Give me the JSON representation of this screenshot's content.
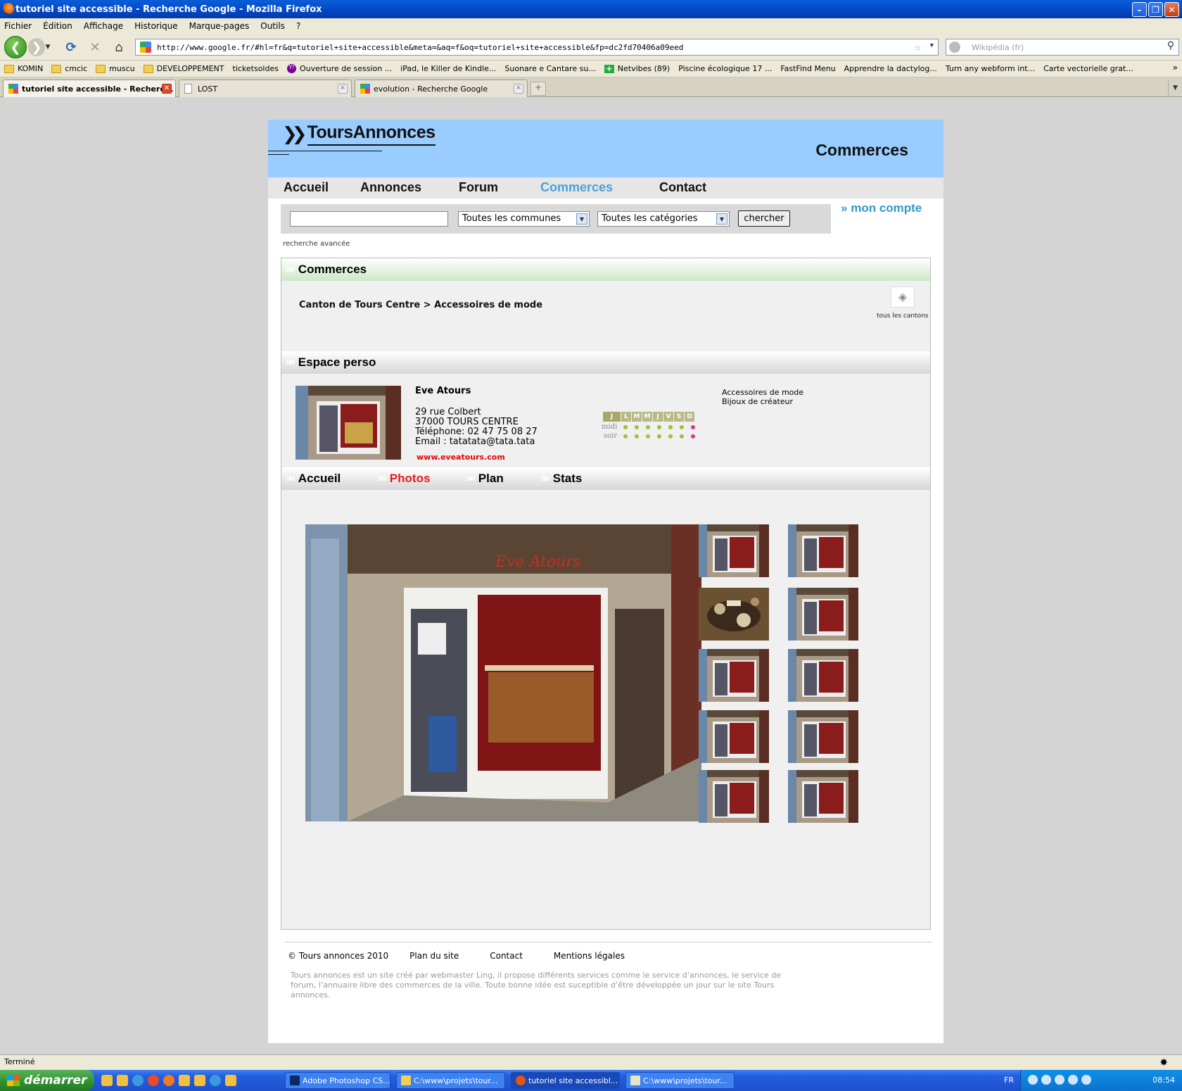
{
  "window": {
    "title": "tutoriel site accessible - Recherche Google - Mozilla Firefox"
  },
  "menu": [
    "Fichier",
    "Édition",
    "Affichage",
    "Historique",
    "Marque-pages",
    "Outils",
    "?"
  ],
  "urlbar": {
    "value": "http://www.google.fr/#hl=fr&q=tutoriel+site+accessible&meta=&aq=f&oq=tutoriel+site+accessible&fp=dc2fd70406a09eed"
  },
  "searchbar": {
    "placeholder": "Wikipédia (fr)"
  },
  "bookmarks": [
    {
      "label": "KOMIN",
      "icon": "folder"
    },
    {
      "label": "cmcic",
      "icon": "folder"
    },
    {
      "label": "muscu",
      "icon": "folder"
    },
    {
      "label": "DEVELOPPEMENT",
      "icon": "folder"
    },
    {
      "label": "ticketsoldes",
      "icon": "page"
    },
    {
      "label": "Ouverture de session ...",
      "icon": "yahoo"
    },
    {
      "label": "iPad, le Killer de Kindle...",
      "icon": "page"
    },
    {
      "label": "Suonare e Cantare su...",
      "icon": "page"
    },
    {
      "label": "Netvibes (89)",
      "icon": "plus"
    },
    {
      "label": "Piscine écologique 17 ...",
      "icon": "page"
    },
    {
      "label": "FastFind Menu",
      "icon": "page"
    },
    {
      "label": "Apprendre la dactylog...",
      "icon": "page"
    },
    {
      "label": "Turn any webform int...",
      "icon": "page"
    },
    {
      "label": "Carte vectorielle grat...",
      "icon": "page"
    }
  ],
  "tabs": [
    {
      "label": "tutoriel site accessible - Recherc...",
      "active": true
    },
    {
      "label": "LOST",
      "active": false
    },
    {
      "label": "evolution - Recherche Google",
      "active": false
    }
  ],
  "site": {
    "logo": "ToursAnnonces",
    "header_title": "Commerces",
    "nav": [
      "Accueil",
      "Annonces",
      "Forum",
      "Commerces",
      "Contact"
    ],
    "search": {
      "communes": "Toutes les communes",
      "categories": "Toutes les catégories",
      "button": "chercher",
      "advanced": "recherche avancée"
    },
    "account": "mon compte",
    "commerces_section": {
      "title": "Commerces",
      "breadcrumb": "Canton de Tours Centre > Accessoires de mode",
      "cantons_label": "tous les cantons"
    },
    "espace_section": {
      "title": "Espace perso"
    },
    "shop": {
      "name": "Eve Atours",
      "address": [
        "29 rue Colbert",
        "37000 TOURS CENTRE",
        "Téléphone: 02 47 75 08 27",
        "Email : tatatata@tata.tata"
      ],
      "website": "www.eveatours.com",
      "categories": [
        "Accessoires de mode",
        "Bijoux de créateur"
      ],
      "hours": {
        "days": [
          "J",
          "L",
          "M",
          "M",
          "J",
          "V",
          "S",
          "D"
        ],
        "midi": "midi",
        "soir": "soir"
      }
    },
    "shop_tabs": [
      {
        "label": "Accueil",
        "current": false
      },
      {
        "label": "Photos",
        "current": true
      },
      {
        "label": "Plan",
        "current": false
      },
      {
        "label": "Stats",
        "current": false
      }
    ],
    "footer": {
      "copyright": "© Tours annonces 2010",
      "links": [
        "Plan du site",
        "Contact",
        "Mentions légales"
      ],
      "text": "Tours annonces est un site créé par webmaster Ling, il propose différents services comme le service d’annonces, le service de forum, l’annuaire libre des commerces de la ville. Toute bonne idée est suceptible d’être développée un jour sur le site Tours annonces."
    }
  },
  "status": "Terminé",
  "taskbar": {
    "start": "démarrer",
    "tasks": [
      "Adobe Photoshop CS...",
      "C:\\www\\projets\\tour...",
      "tutoriel site accessibl...",
      "C:\\www\\projets\\tour..."
    ],
    "lang": "FR",
    "clock": "08:54"
  },
  "colors": {
    "header_bg": "#99ccff",
    "nav_current": "#4aa0d8",
    "tab_current": "#e41d1d",
    "account": "#3399cc",
    "website": "#ee0000"
  }
}
